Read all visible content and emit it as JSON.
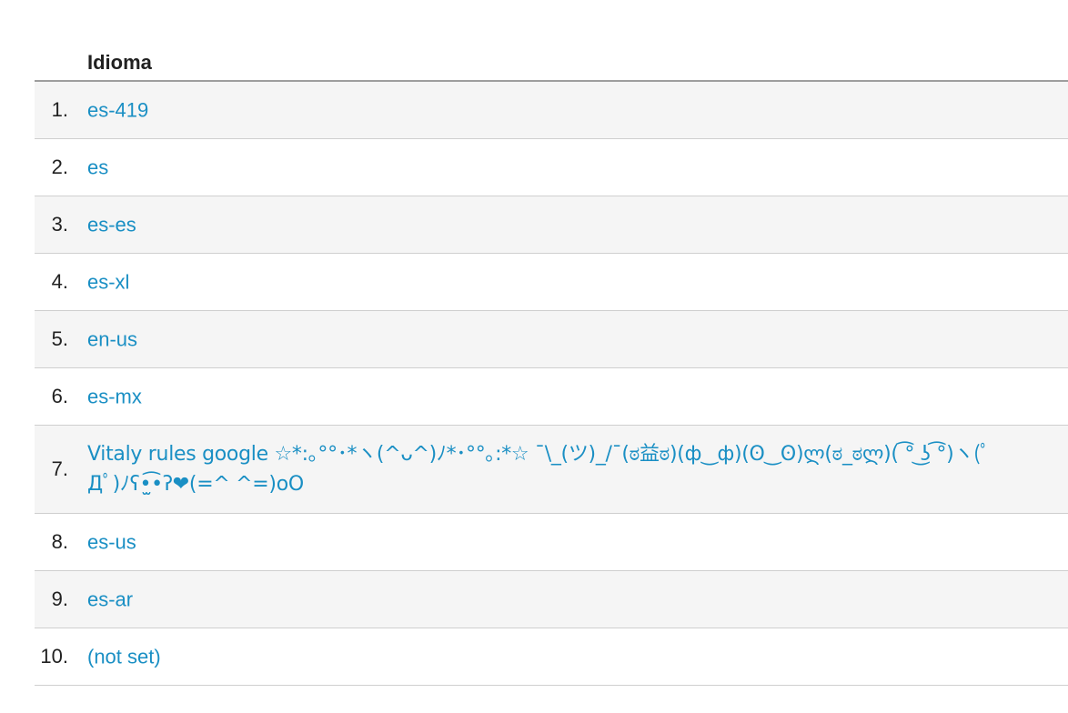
{
  "table": {
    "header": "Idioma",
    "rows": [
      {
        "index": "1.",
        "label": "es-419"
      },
      {
        "index": "2.",
        "label": "es"
      },
      {
        "index": "3.",
        "label": "es-es"
      },
      {
        "index": "4.",
        "label": "es-xl"
      },
      {
        "index": "5.",
        "label": "en-us"
      },
      {
        "index": "6.",
        "label": "es-mx"
      },
      {
        "index": "7.",
        "label": "Vitaly rules google ☆*:｡°°･*ヽ(^ᴗ^)ﾉ*･°°｡:*☆ ¯\\_(ツ)_/¯(ಠ益ಠ)(ф‿ф)(ʘ‿ʘ)ლ(ಠ_ಠლ)( ͡° ͜ʖ ͡°)ヽ(ﾟДﾟ)ﾉʕ•̫͡•ʔ❤(=^ ^=)oO"
      },
      {
        "index": "8.",
        "label": "es-us"
      },
      {
        "index": "9.",
        "label": "es-ar"
      },
      {
        "index": "10.",
        "label": "(not set)"
      }
    ]
  }
}
